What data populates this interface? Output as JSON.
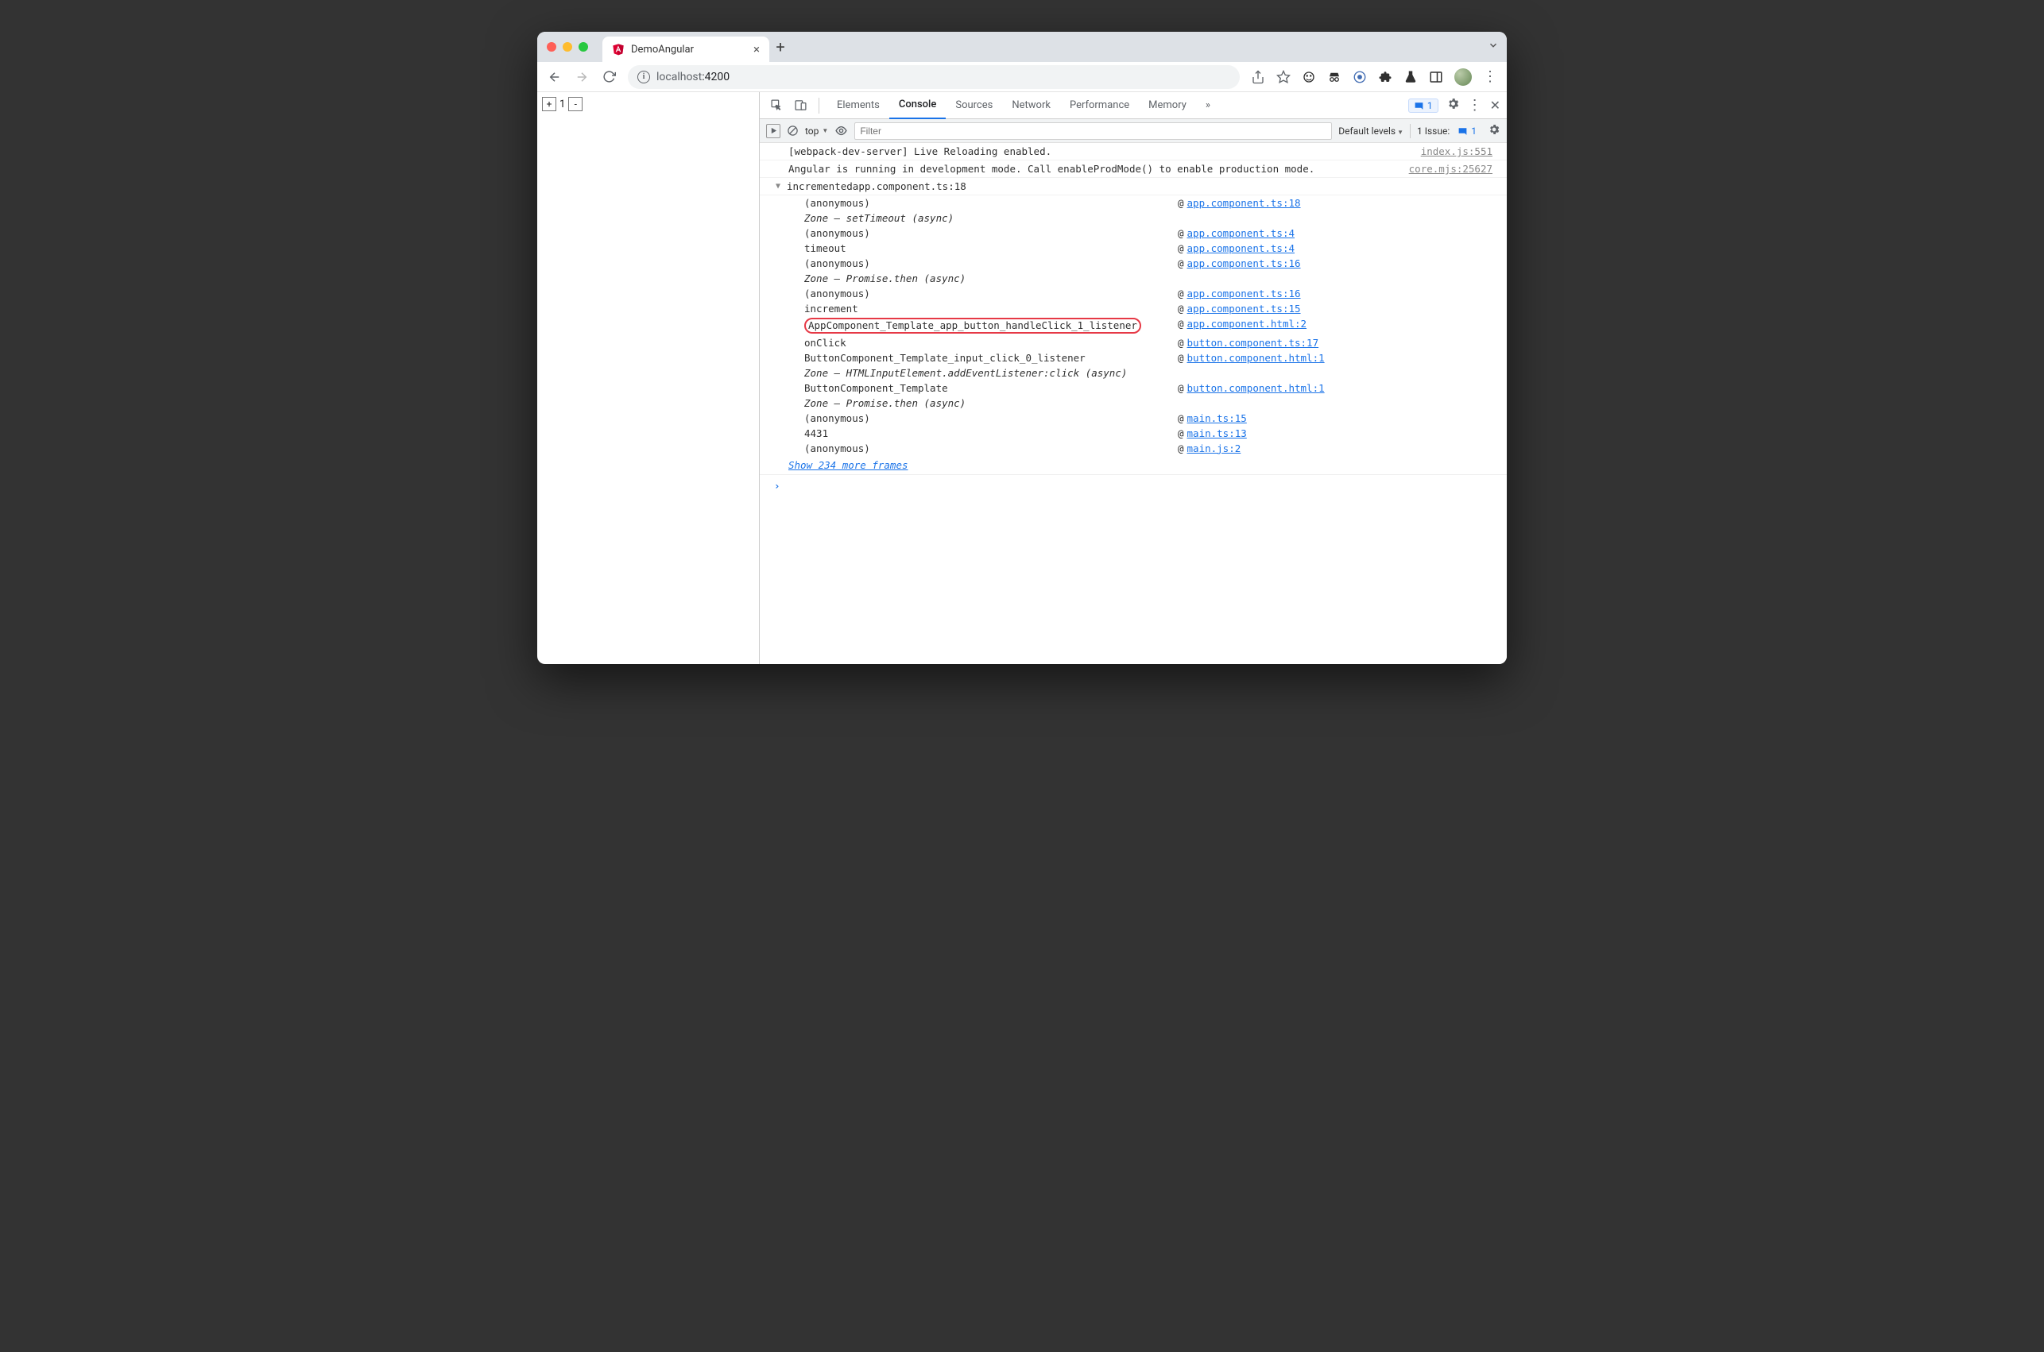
{
  "browser": {
    "tab_title": "DemoAngular",
    "url_host": "localhost",
    "url_port": ":4200"
  },
  "page": {
    "counter_value": "1"
  },
  "devtools": {
    "tabs": [
      "Elements",
      "Console",
      "Sources",
      "Network",
      "Performance",
      "Memory"
    ],
    "active_tab": "Console",
    "more_label": "»",
    "chip_count": "1",
    "issues_text": "1 Issue:",
    "issues_count": "1",
    "context_label": "top",
    "filter_placeholder": "Filter",
    "levels_label": "Default levels"
  },
  "console": {
    "rows": [
      {
        "msg": "[webpack-dev-server] Live Reloading enabled.",
        "src": "index.js:551"
      },
      {
        "msg": "Angular is running in development mode. Call enableProdMode() to enable production mode.",
        "src": "core.mjs:25627"
      }
    ],
    "group_label": "incremented",
    "group_src": "app.component.ts:18",
    "stack": [
      {
        "fn": "(anonymous)",
        "loc": "app.component.ts:18"
      },
      {
        "fn": "Zone – setTimeout (async)",
        "zone": true
      },
      {
        "fn": "(anonymous)",
        "loc": "app.component.ts:4"
      },
      {
        "fn": "timeout",
        "loc": "app.component.ts:4"
      },
      {
        "fn": "(anonymous)",
        "loc": "app.component.ts:16"
      },
      {
        "fn": "Zone – Promise.then (async)",
        "zone": true
      },
      {
        "fn": "(anonymous)",
        "loc": "app.component.ts:16"
      },
      {
        "fn": "increment",
        "loc": "app.component.ts:15"
      },
      {
        "fn": "AppComponent_Template_app_button_handleClick_1_listener",
        "loc": "app.component.html:2",
        "highlight": true
      },
      {
        "fn": "onClick",
        "loc": "button.component.ts:17"
      },
      {
        "fn": "ButtonComponent_Template_input_click_0_listener",
        "loc": "button.component.html:1"
      },
      {
        "fn": "Zone – HTMLInputElement.addEventListener:click (async)",
        "zone": true
      },
      {
        "fn": "ButtonComponent_Template",
        "loc": "button.component.html:1"
      },
      {
        "fn": "Zone – Promise.then (async)",
        "zone": true
      },
      {
        "fn": "(anonymous)",
        "loc": "main.ts:15"
      },
      {
        "fn": "4431",
        "loc": "main.ts:13"
      },
      {
        "fn": "(anonymous)",
        "loc": "main.js:2"
      }
    ],
    "show_more": "Show 234 more frames",
    "prompt": "›"
  }
}
